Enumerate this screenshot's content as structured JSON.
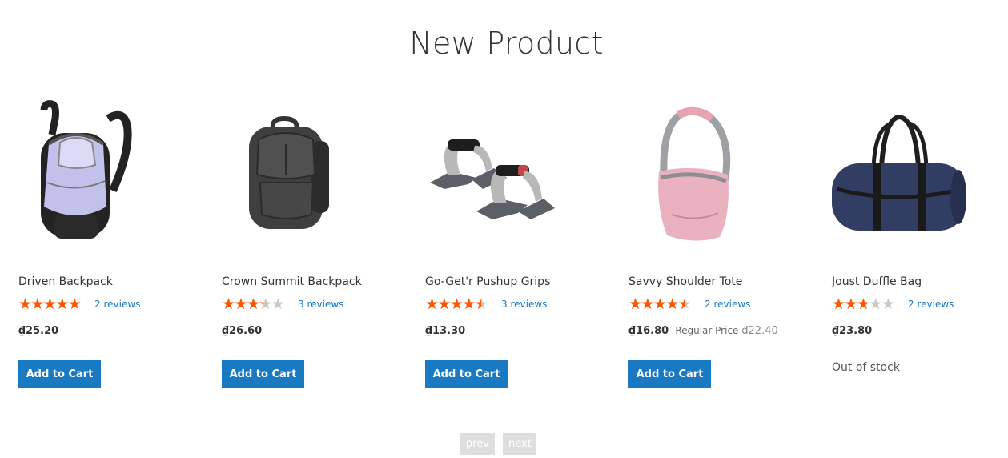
{
  "section": {
    "title": "New Product"
  },
  "currency_symbol": "₫",
  "products": [
    {
      "name": "Driven Backpack",
      "rating_fraction": 0.9,
      "reviews": "2 reviews",
      "price": "₫25.20",
      "old_price_label": "",
      "old_price": "",
      "action": "Add to Cart",
      "stock": "",
      "image_icon": "backpack-icon",
      "image_color": "#b4b3e0"
    },
    {
      "name": "Crown Summit Backpack",
      "rating_fraction": 0.6,
      "reviews": "3 reviews",
      "price": "₫26.60",
      "old_price_label": "",
      "old_price": "",
      "action": "Add to Cart",
      "stock": "",
      "image_icon": "backpack-icon",
      "image_color": "#4a4a4a"
    },
    {
      "name": "Go-Get'r Pushup Grips",
      "rating_fraction": 0.8,
      "reviews": "3 reviews",
      "price": "₫13.30",
      "old_price_label": "",
      "old_price": "",
      "action": "Add to Cart",
      "stock": "",
      "image_icon": "pushup-grips-icon",
      "image_color": "#5b5e63"
    },
    {
      "name": "Savvy Shoulder Tote",
      "rating_fraction": 0.8,
      "reviews": "2 reviews",
      "price": "₫16.80",
      "old_price_label": "Regular Price",
      "old_price": "₫22.40",
      "action": "Add to Cart",
      "stock": "",
      "image_icon": "tote-bag-icon",
      "image_color": "#e8aab8"
    },
    {
      "name": "Joust Duffle Bag",
      "rating_fraction": 0.5,
      "reviews": "2 reviews",
      "price": "₫23.80",
      "old_price_label": "",
      "old_price": "",
      "action": "",
      "stock": "Out of stock",
      "image_icon": "duffle-bag-icon",
      "image_color": "#2e3a5e"
    }
  ],
  "pager": {
    "prev": "prev",
    "next": "next"
  },
  "colors": {
    "accent": "#1979c3",
    "star": "#ff5501",
    "star_empty": "#c8c8c8"
  }
}
